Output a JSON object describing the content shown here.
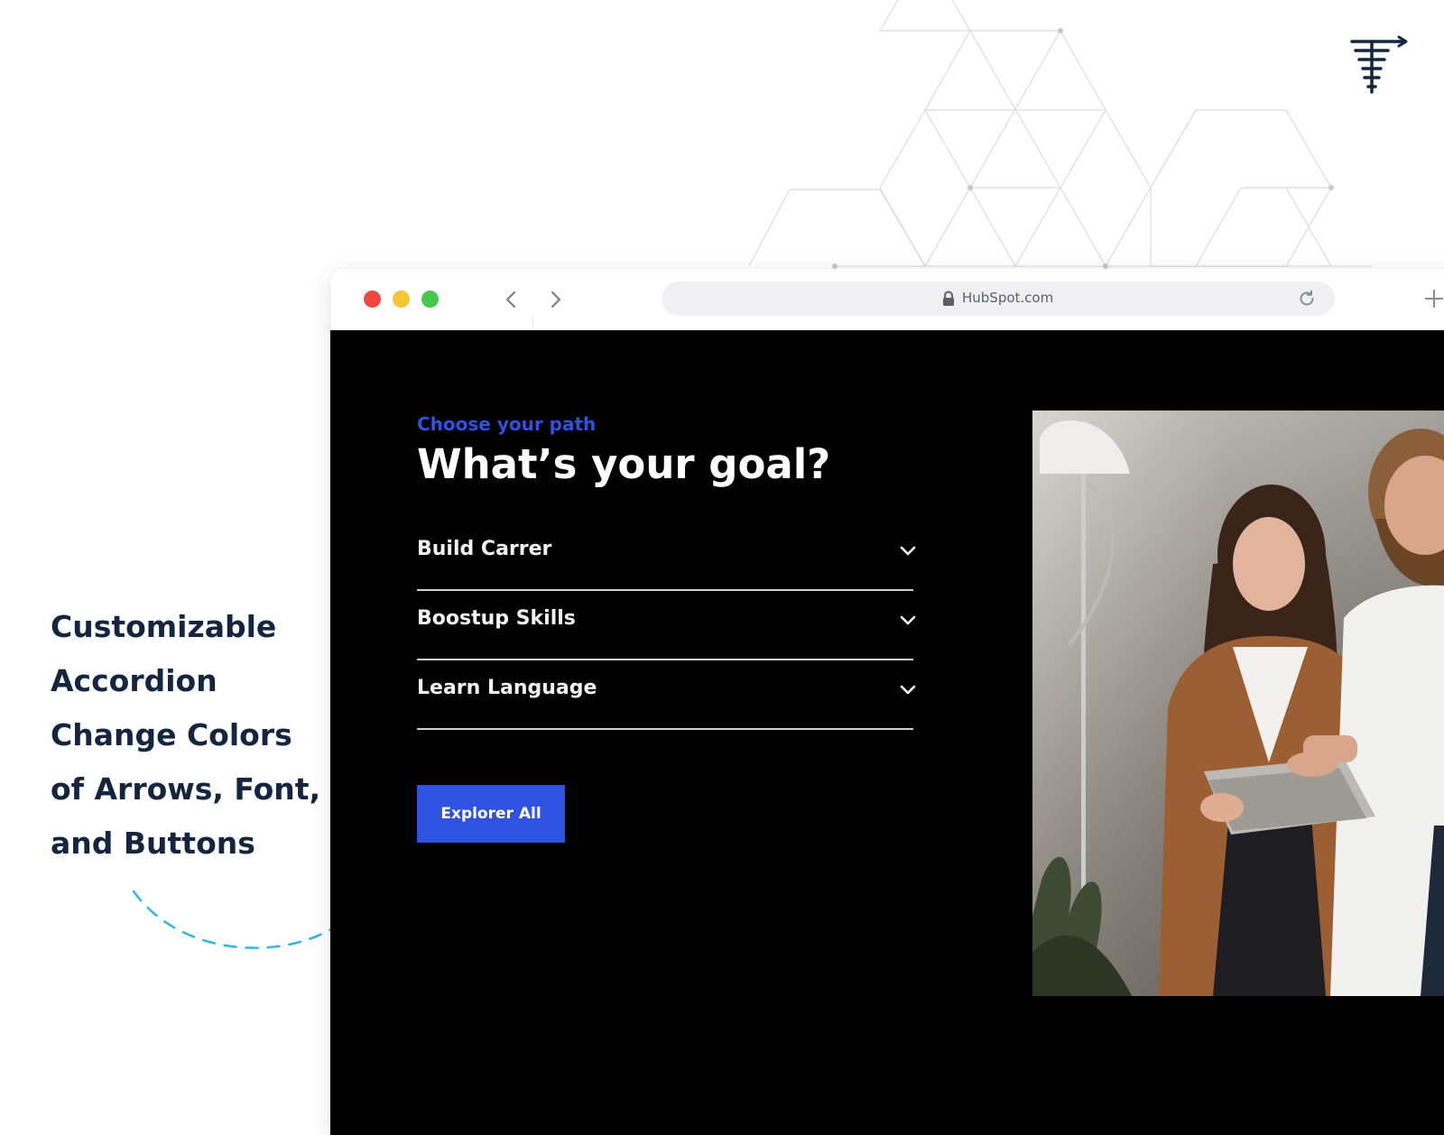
{
  "feature_callout": {
    "lines": [
      "Customizable",
      "Accordion",
      "Change Colors",
      "of Arrows, Font,",
      "and Buttons"
    ]
  },
  "browser": {
    "url": "HubSpot.com",
    "icons": [
      "back-icon",
      "forward-icon",
      "lock-icon",
      "reload-icon",
      "plus-icon"
    ]
  },
  "page": {
    "eyebrow": "Choose your path",
    "headline": "What’s your goal?",
    "accordion": [
      {
        "label": "Build Carrer"
      },
      {
        "label": "Boostup Skills"
      },
      {
        "label": "Learn Language"
      }
    ],
    "cta_label": "Explorer All"
  },
  "colors": {
    "accent": "#3052e0",
    "navy_text": "#14263f",
    "page_background": "#000000",
    "arrow": "#2bb8e6"
  }
}
